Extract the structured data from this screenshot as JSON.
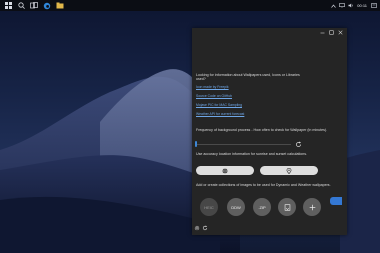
{
  "taskbar": {
    "icons": [
      "start-icon",
      "search-icon",
      "task-view-icon",
      "edge-icon",
      "explorer-icon"
    ],
    "tray": [
      "chevron-up-icon",
      "network-icon",
      "volume-icon",
      "notification-icon"
    ],
    "clock": "00:11"
  },
  "window": {
    "controls": [
      "minimize-icon",
      "maximize-icon",
      "close-icon"
    ]
  },
  "content": {
    "intro": "Looking for information about Wallpapers used, Icons or Libraries used?",
    "links": [
      "Icon made by Freepik",
      "Source Code on GitHub",
      "Mojave PIC for MAC Sampling",
      "Weather API for current forecast"
    ],
    "frequency_label": "Frequency of background process - How often to check for Wallpaper (in minutes).",
    "slider_value": 0,
    "accuracy_label": "Use accuracy location information for sunrise and sunset calculations.",
    "location_buttons": [
      "globe-icon",
      "location-pin-icon"
    ],
    "collections_label": "Add or create collections of images to be used for Dynamic and Weather wallpapers.",
    "collection_buttons": [
      "HEIC",
      "DDW",
      ".ZIP",
      "folder-add-icon",
      "plus-icon"
    ],
    "footer_icons": [
      "settings-icon",
      "refresh-icon"
    ]
  },
  "colors": {
    "accent": "#3478d4",
    "panel_bg": "#252525",
    "link": "#6ea6e6"
  }
}
